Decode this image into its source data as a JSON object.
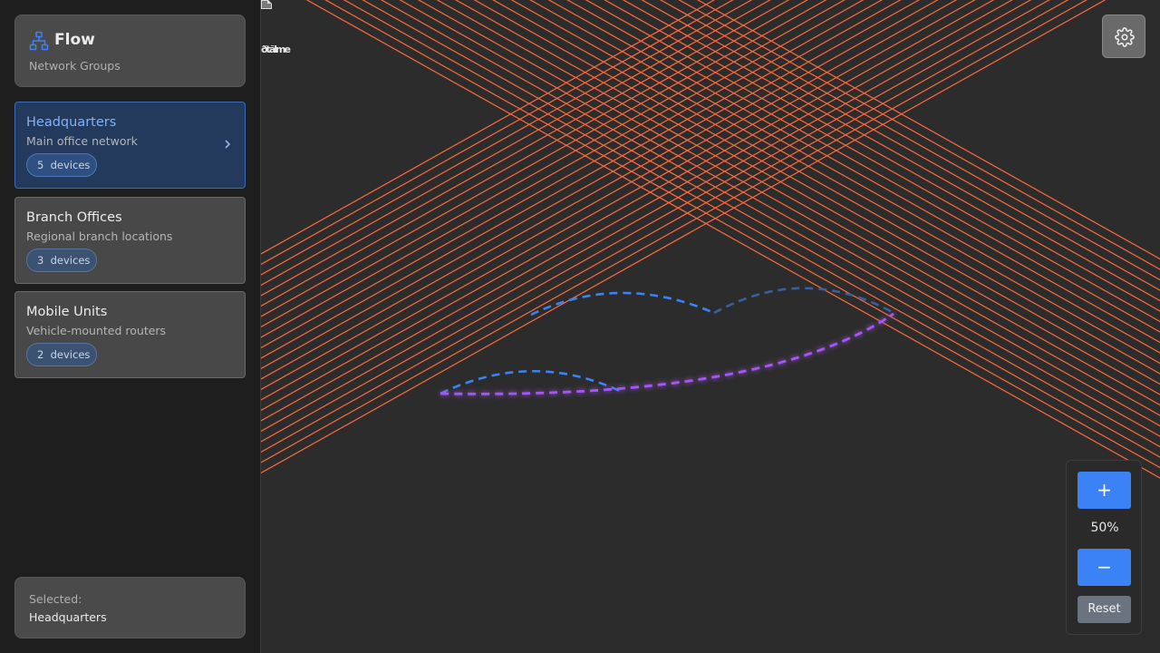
{
  "brand": {
    "title": "Flow",
    "subtitle": "Network Groups",
    "icon": "network-icon"
  },
  "groups": [
    {
      "name": "Headquarters",
      "description": "Main office network",
      "badge": "5  devices",
      "active": true
    },
    {
      "name": "Branch Offices",
      "description": "Regional branch locations",
      "badge": "3  devices",
      "active": false
    },
    {
      "name": "Mobile Units",
      "description": "Vehicle-mounted routers",
      "badge": "2  devices",
      "active": false
    }
  ],
  "selected": {
    "label": "Selected:",
    "value": "Headquarters"
  },
  "canvas": {
    "edge_label": "ðtãlme"
  },
  "zoom": {
    "in_label": "+",
    "level": "50%",
    "out_label": "−",
    "reset_label": "Reset"
  },
  "colors": {
    "accent": "#3b82f6",
    "grid_line": "#ff6a3d",
    "edge_blue": "#3b82f6",
    "edge_purple": "#a855f7",
    "active_group_bg": "#243a5c"
  }
}
